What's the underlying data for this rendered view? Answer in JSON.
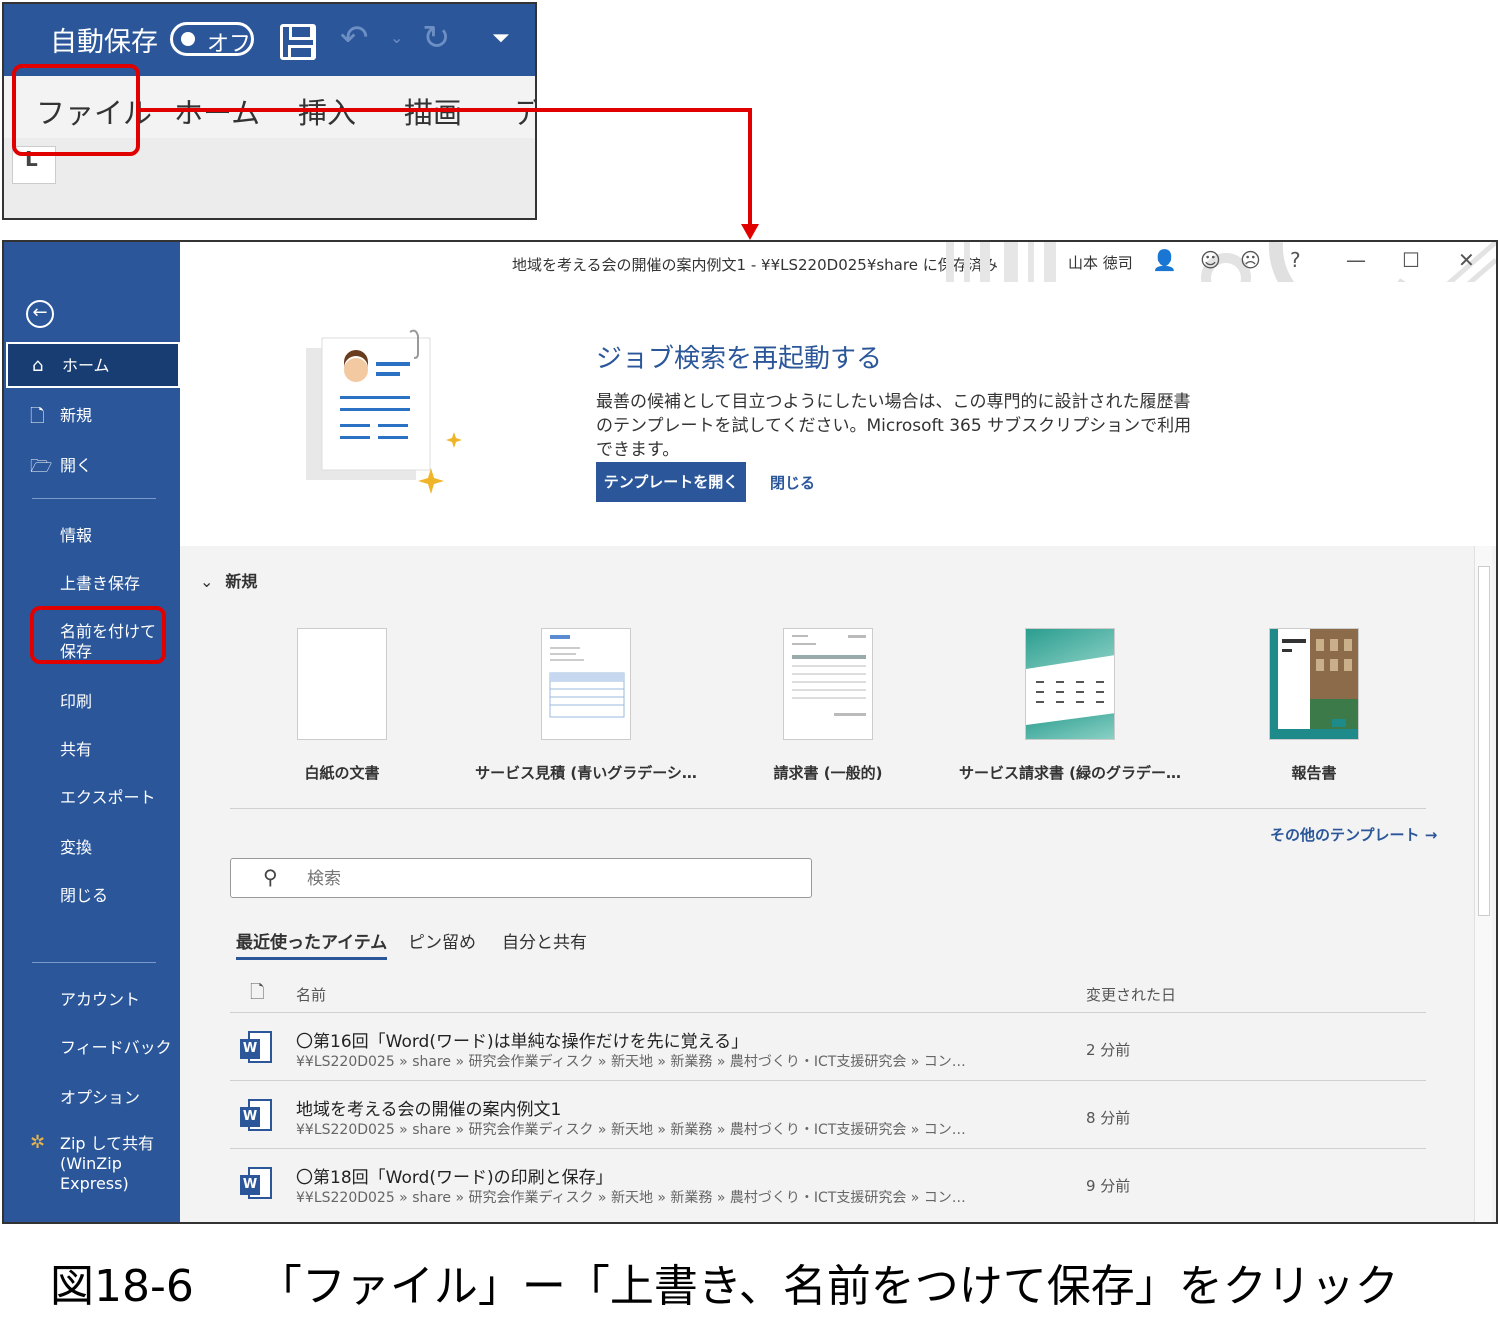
{
  "ribbon": {
    "autosave_label": "自動保存",
    "toggle_label": "オフ",
    "tabs": [
      "ファイル",
      "ホーム",
      "挿入",
      "描画",
      "デ"
    ]
  },
  "window": {
    "title": "地域を考える会の開催の案内例文1  -  ¥¥LS220D025¥share に保存済み",
    "user": "山本 徳司"
  },
  "sidebar": {
    "items": [
      "ホーム",
      "新規",
      "開く",
      "情報",
      "上書き保存",
      "名前を付けて保存",
      "印刷",
      "共有",
      "エクスポート",
      "変換",
      "閉じる",
      "アカウント",
      "フィードバック",
      "オプション",
      "Zip して共有 (WinZip Express)"
    ]
  },
  "banner": {
    "title": "ジョブ検索を再起動する",
    "body": "最善の候補として目立つようにしたい場合は、この専門的に設計された履歴書のテンプレートを試してください。Microsoft 365 サブスクリプションで利用できます。",
    "open_button": "テンプレートを開く",
    "close_link": "閉じる"
  },
  "new_section": {
    "heading": "新規",
    "templates": [
      "白紙の文書",
      "サービス見積 (青いグラデーシ…",
      "請求書 (一般的)",
      "サービス請求書 (緑のグラデー…",
      "報告書"
    ],
    "more_templates": "その他のテンプレート  →"
  },
  "search": {
    "placeholder": "検索"
  },
  "recent": {
    "tabs": [
      "最近使ったアイテム",
      "ピン留め",
      "自分と共有"
    ],
    "col_name": "名前",
    "col_date": "変更された日",
    "files": [
      {
        "name": "〇第16回「Word(ワード)は単純な操作だけを先に覚える」",
        "path": "¥¥LS220D025 » share » 研究会作業ディスク » 新天地 » 新業務 » 農村づくり・ICT支援研究会 » コン…",
        "date": "2 分前"
      },
      {
        "name": "地域を考える会の開催の案内例文1",
        "path": "¥¥LS220D025 » share » 研究会作業ディスク » 新天地 » 新業務 » 農村づくり・ICT支援研究会 » コン…",
        "date": "8 分前"
      },
      {
        "name": "〇第18回「Word(ワード)の印刷と保存」",
        "path": "¥¥LS220D025 » share » 研究会作業ディスク » 新天地 » 新業務 » 農村づくり・ICT支援研究会 » コン…",
        "date": "9 分前"
      }
    ]
  },
  "caption": {
    "number": "図18-6",
    "text": "「ファイル」ー「上書き、名前をつけて保存」をクリック"
  },
  "colors": {
    "accent": "#2b579a",
    "highlight": "#e00000"
  }
}
